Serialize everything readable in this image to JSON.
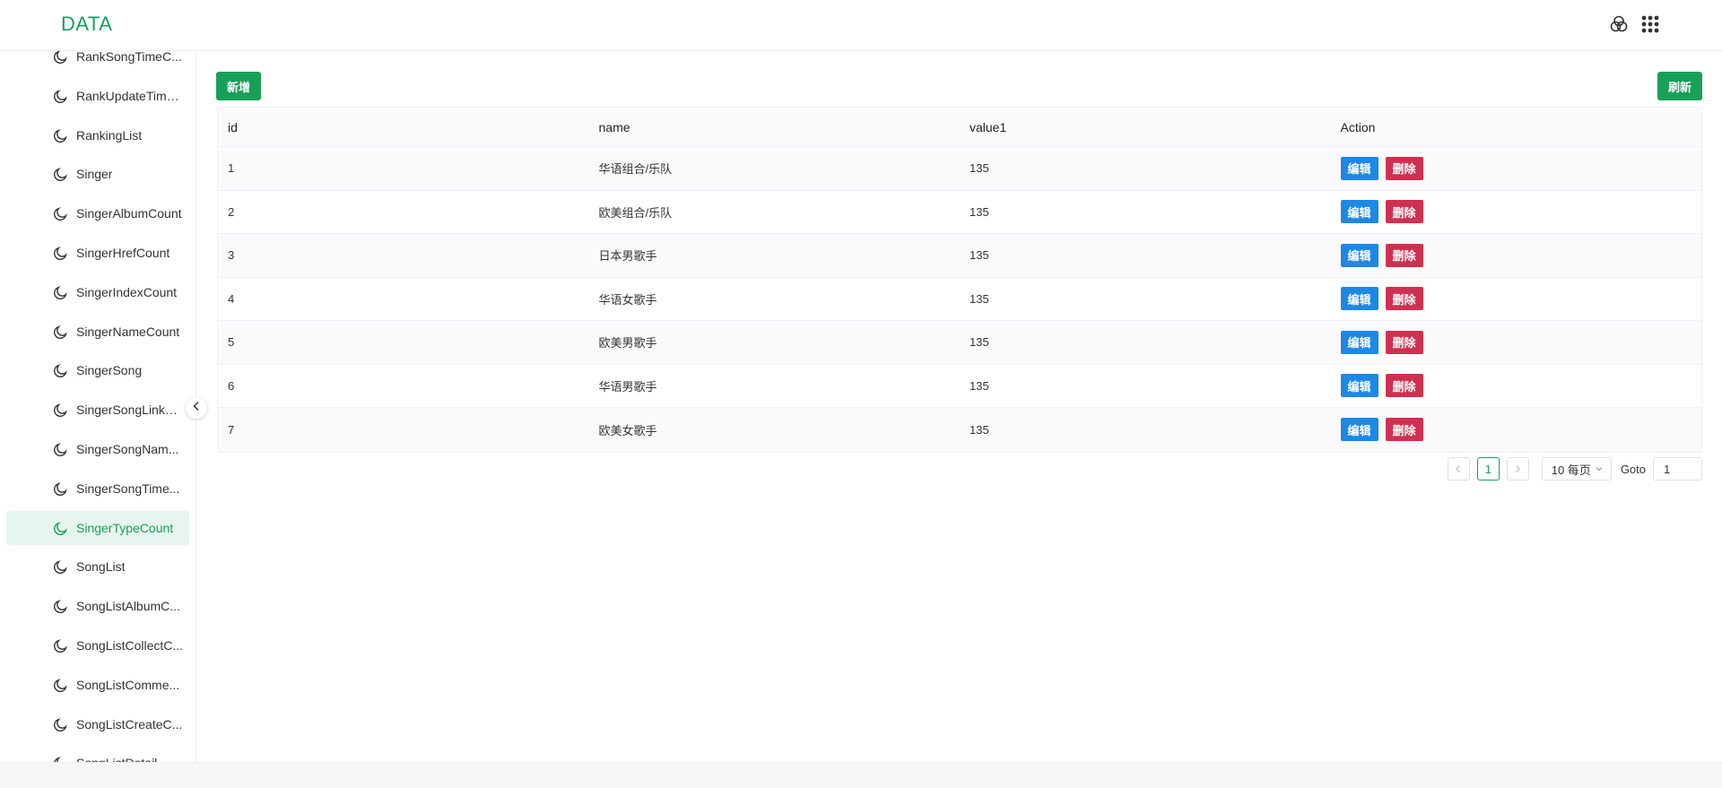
{
  "header": {
    "brand": "DATA"
  },
  "sidebar": {
    "items": [
      {
        "label": "RankSongTimeC..."
      },
      {
        "label": "RankUpdateTime..."
      },
      {
        "label": "RankingList"
      },
      {
        "label": "Singer"
      },
      {
        "label": "SingerAlbumCount"
      },
      {
        "label": "SingerHrefCount"
      },
      {
        "label": "SingerIndexCount"
      },
      {
        "label": "SingerNameCount"
      },
      {
        "label": "SingerSong"
      },
      {
        "label": "SingerSongLinkC..."
      },
      {
        "label": "SingerSongNam..."
      },
      {
        "label": "SingerSongTime..."
      },
      {
        "label": "SingerTypeCount",
        "active": true
      },
      {
        "label": "SongList"
      },
      {
        "label": "SongListAlbumC..."
      },
      {
        "label": "SongListCollectC..."
      },
      {
        "label": "SongListComme..."
      },
      {
        "label": "SongListCreateC..."
      },
      {
        "label": "SongListDetail..."
      }
    ]
  },
  "toolbar": {
    "add_label": "新增",
    "refresh_label": "刷新"
  },
  "table": {
    "columns": [
      "id",
      "name",
      "value1",
      "Action"
    ],
    "rows": [
      {
        "id": "1",
        "name": "华语组合/乐队",
        "value1": "135"
      },
      {
        "id": "2",
        "name": "欧美组合/乐队",
        "value1": "135"
      },
      {
        "id": "3",
        "name": "日本男歌手",
        "value1": "135"
      },
      {
        "id": "4",
        "name": "华语女歌手",
        "value1": "135"
      },
      {
        "id": "5",
        "name": "欧美男歌手",
        "value1": "135"
      },
      {
        "id": "6",
        "name": "华语男歌手",
        "value1": "135"
      },
      {
        "id": "7",
        "name": "欧美女歌手",
        "value1": "135"
      }
    ],
    "edit_label": "编辑",
    "delete_label": "删除"
  },
  "pagination": {
    "current_page": "1",
    "page_size": "10 每页",
    "goto_label": "Goto",
    "goto_value": "1"
  },
  "colors": {
    "brand": "#18a058",
    "edit": "#1e88e5",
    "delete": "#d03050"
  },
  "icons": {
    "menu_item": "moon-icon",
    "header_left": "theme-circles-icon",
    "header_right": "apps-grid-icon"
  }
}
